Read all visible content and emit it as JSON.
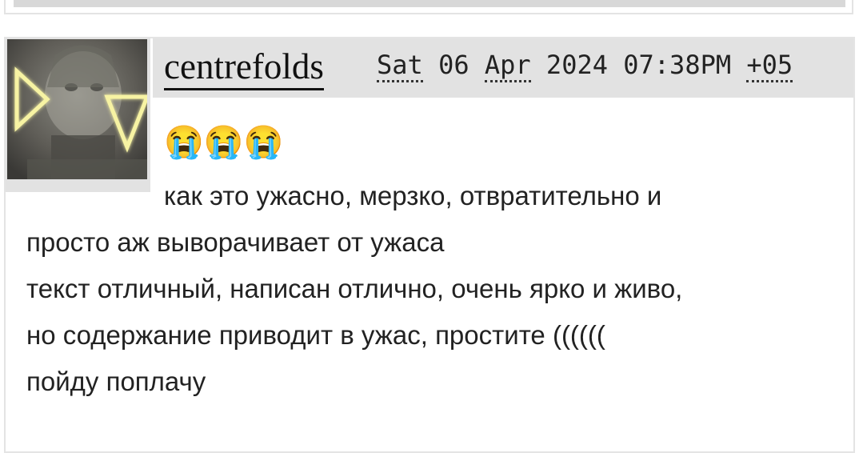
{
  "comment": {
    "username": "centrefolds",
    "timestamp": {
      "day": "Sat",
      "date": "06",
      "month": "Apr",
      "year": "2024",
      "time": "07:38PM",
      "tz": "+05"
    },
    "emojis": "😭😭😭",
    "body_lines": [
      "как это ужасно, мерзко, отвратительно и",
      "просто аж выворачивает от ужаса",
      "текст отличный, написан отлично, очень ярко и живо,",
      "но содержание приводит в ужас, простите ((((((",
      "пойду поплачу"
    ]
  }
}
